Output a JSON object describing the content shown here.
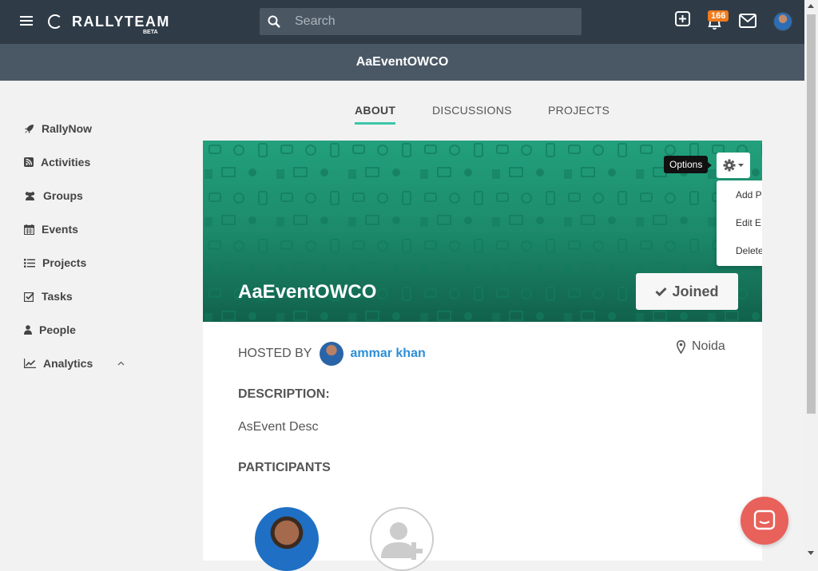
{
  "topbar": {
    "logo_text": "RALLYTEAM",
    "logo_beta": "BETA",
    "search_placeholder": "Search",
    "notification_count": "166"
  },
  "subbar": {
    "title": "AaEventOWCO"
  },
  "sidebar": {
    "items": [
      {
        "label": "RallyNow",
        "icon": "rocket-icon"
      },
      {
        "label": "Activities",
        "icon": "rss-icon"
      },
      {
        "label": "Groups",
        "icon": "users-icon"
      },
      {
        "label": "Events",
        "icon": "calendar-icon"
      },
      {
        "label": "Projects",
        "icon": "list-icon"
      },
      {
        "label": "Tasks",
        "icon": "checkbox-icon"
      },
      {
        "label": "People",
        "icon": "user-icon"
      },
      {
        "label": "Analytics",
        "icon": "chart-icon"
      }
    ]
  },
  "tabs": [
    {
      "label": "ABOUT",
      "active": true
    },
    {
      "label": "DISCUSSIONS",
      "active": false
    },
    {
      "label": "PROJECTS",
      "active": false
    }
  ],
  "event": {
    "title": "AaEventOWCO",
    "joined_label": "Joined",
    "options_tooltip": "Options",
    "dropdown": [
      "Add P",
      "Edit E",
      "Delete"
    ],
    "hosted_by_label": "HOSTED BY",
    "host_name": "ammar khan",
    "location": "Noida",
    "description_heading": "DESCRIPTION:",
    "description": "AsEvent Desc",
    "participants_heading": "PARTICIPANTS"
  },
  "colors": {
    "topbar": "#2f3c48",
    "subbar": "#4a5866",
    "accent": "#3cc6a8",
    "banner": "#1c8a6b",
    "link": "#2e8fd6",
    "badge": "#f07c1e",
    "chat": "#e8615a"
  }
}
